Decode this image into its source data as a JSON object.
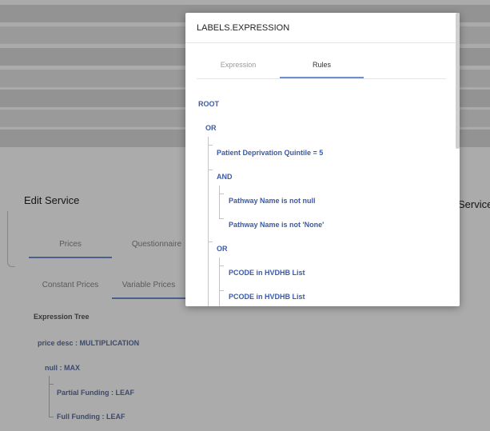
{
  "background": {
    "edit_title": "Edit Service",
    "service_label": "Service",
    "main_tabs": [
      "Prices",
      "Questionnaire"
    ],
    "price_tabs": [
      "Constant Prices",
      "Variable Prices"
    ],
    "expression_tree_heading": "Expression Tree",
    "tree": [
      "price desc : MULTIPLICATION",
      "null : MAX",
      "Partial Funding : LEAF",
      "Full Funding : LEAF"
    ]
  },
  "modal": {
    "title": "LABELS.EXPRESSION",
    "tabs": [
      "Expression",
      "Rules"
    ],
    "active_tab": "Rules",
    "rules": {
      "root": "ROOT",
      "or_1": "OR",
      "quintile": "Patient Deprivation Quintile = 5",
      "and": "AND",
      "pathway_not_null": "Pathway Name is not null",
      "pathway_not_none": "Pathway Name is not 'None'",
      "or_2": "OR",
      "pcode_1": "PCODE in HVDHB List",
      "pcode_2": "PCODE in HVDHB List"
    }
  },
  "colors": {
    "accent": "#6f8ecf",
    "rule_text": "#3b5aa6",
    "overlay": "rgba(0,0,0,0.33)"
  }
}
